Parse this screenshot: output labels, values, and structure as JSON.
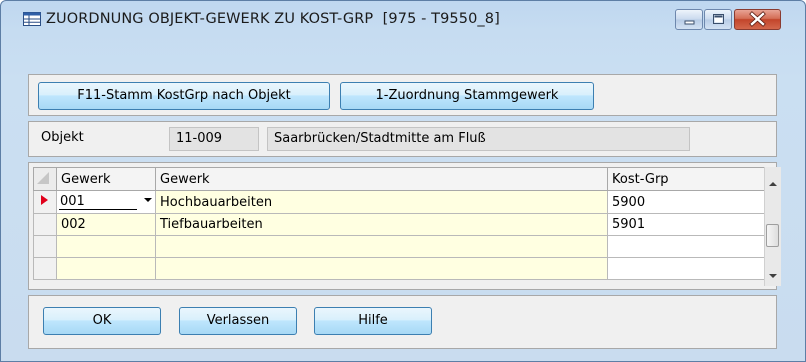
{
  "window": {
    "title": "ZUORDNUNG OBJEKT-GEWERK ZU KOST-GRP  [975 - T9550_8]",
    "icon": "table-icon",
    "controls": [
      "minimize-icon",
      "maximize-icon",
      "close-icon"
    ]
  },
  "toolbar": {
    "f11_label": "F11-Stamm KostGrp nach Objekt",
    "zuordnung_label": "1-Zuordnung Stammgewerk"
  },
  "objekt": {
    "label": "Objekt",
    "code": "11-009",
    "name": "Saarbrücken/Stadtmitte am Fluß"
  },
  "grid": {
    "columns": [
      "Gewerk",
      "Gewerk",
      "Kost-Grp"
    ],
    "rows": [
      {
        "code": "001",
        "name": "Hochbauarbeiten",
        "kostgrp": "5900",
        "current": true
      },
      {
        "code": "002",
        "name": "Tiefbauarbeiten",
        "kostgrp": "5901",
        "current": false
      },
      {
        "code": "",
        "name": "",
        "kostgrp": "",
        "current": false
      },
      {
        "code": "",
        "name": "",
        "kostgrp": "",
        "current": false
      }
    ]
  },
  "footer": {
    "ok_label": "OK",
    "verlassen_label": "Verlassen",
    "hilfe_label": "Hilfe"
  },
  "colors": {
    "frame": "#c6dcf1",
    "button": "#bee6fd",
    "editable_cell": "#ffffe1",
    "row_indicator": "#e0001b"
  }
}
